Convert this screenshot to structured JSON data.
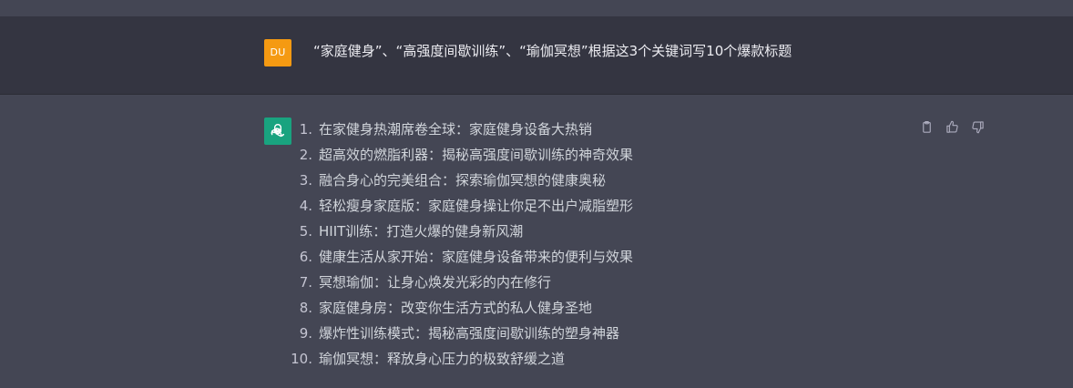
{
  "user_message": {
    "avatar_initials": "DU",
    "avatar_color": "#f59a12",
    "text": "“家庭健身”、“高强度间歇训练”、“瑜伽冥想”根据这3个关键词写10个爆款标题"
  },
  "assistant_message": {
    "avatar_icon": "openai-logo-icon",
    "avatar_color": "#19a37f",
    "items": [
      {
        "number": "1.",
        "text": "在家健身热潮席卷全球：家庭健身设备大热销"
      },
      {
        "number": "2.",
        "text": "超高效的燃脂利器：揭秘高强度间歇训练的神奇效果"
      },
      {
        "number": "3.",
        "text": "融合身心的完美组合：探索瑜伽冥想的健康奥秘"
      },
      {
        "number": "4.",
        "text": "轻松瘦身家庭版：家庭健身操让你足不出户减脂塑形"
      },
      {
        "number": "5.",
        "text": "HIIT训练：打造火爆的健身新风潮"
      },
      {
        "number": "6.",
        "text": "健康生活从家开始：家庭健身设备带来的便利与效果"
      },
      {
        "number": "7.",
        "text": "冥想瑜伽：让身心焕发光彩的内在修行"
      },
      {
        "number": "8.",
        "text": "家庭健身房：改变你生活方式的私人健身圣地"
      },
      {
        "number": "9.",
        "text": "爆炸性训练模式：揭秘高强度间歇训练的塑身神器"
      },
      {
        "number": "10.",
        "text": "瑜伽冥想：释放身心压力的极致舒缓之道"
      }
    ],
    "actions": [
      "clipboard-icon",
      "thumbs-up-icon",
      "thumbs-down-icon"
    ]
  }
}
